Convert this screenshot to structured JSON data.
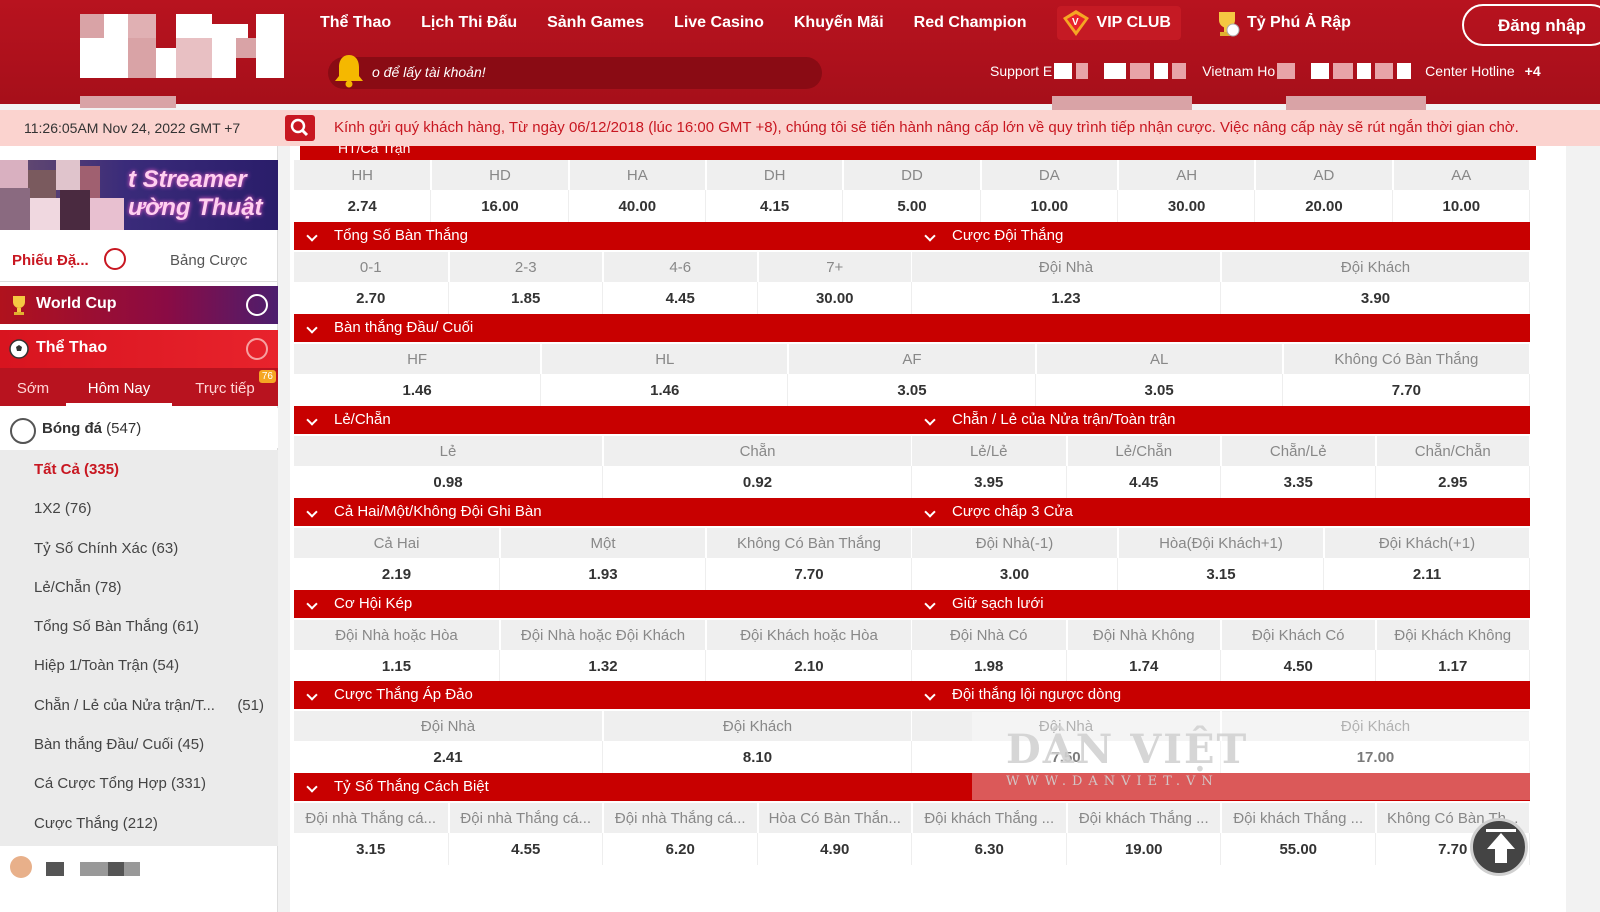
{
  "header": {
    "nav": [
      "Thể Thao",
      "Lịch Thi Đấu",
      "Sảnh Games",
      "Live Casino",
      "Khuyến Mãi",
      "Red Champion"
    ],
    "vip_label": "VIP CLUB",
    "ty_phu_label": "Tỷ Phú Ả Rập",
    "login_label": "Đăng nhập",
    "promo_text": "o để lấy tài khoản!",
    "support_label": "Support E",
    "vietnam_label": "Vietnam Ho",
    "hotline_label": "Center Hotline",
    "hotline_suffix": "+4"
  },
  "ticker": {
    "time": "11:26:05AM Nov 24, 2022 GMT +7",
    "message": "Kính gửi quý khách hàng, Từ ngày 06/12/2018 (lúc 16:00 GMT +8), chúng tôi sẽ tiến hành nâng cấp lớn về quy trình tiếp nhận cược. Việc nâng cấp này sẽ rút ngắn thời gian chờ."
  },
  "sidebar": {
    "banner_line1": "t Streamer",
    "banner_line2": "ường Thuật",
    "tab_active": "Phiếu Đặ...",
    "tab_other": "Bảng Cược",
    "world_cup": "World Cup",
    "the_thao": "Thể Thao",
    "subtabs": [
      "Sớm",
      "Hôm Nay",
      "Trực tiếp"
    ],
    "live_count": "76",
    "sport": "Bóng đá",
    "sport_count": "(547)",
    "items": [
      {
        "label": "Tất Cả (335)",
        "count": ""
      },
      {
        "label": "1X2 (76)",
        "count": ""
      },
      {
        "label": "Tỷ Số Chính Xác (63)",
        "count": ""
      },
      {
        "label": "Lẻ/Chẵn (78)",
        "count": ""
      },
      {
        "label": "Tổng Số Bàn Thắng (61)",
        "count": ""
      },
      {
        "label": "Hiệp 1/Toàn Trận (54)",
        "count": ""
      },
      {
        "label": "Chẵn / Lẻ của Nửa trận/T...",
        "count": "(51)"
      },
      {
        "label": "Bàn thắng Đầu/ Cuối (45)",
        "count": ""
      },
      {
        "label": "Cá Cược Tổng Hợp (331)",
        "count": ""
      },
      {
        "label": "Cược Thắng (212)",
        "count": ""
      }
    ]
  },
  "odds": {
    "top_header": "HT/Cả Trận",
    "top": {
      "labels": [
        "HH",
        "HD",
        "HA",
        "DH",
        "DD",
        "DA",
        "AH",
        "AD",
        "AA"
      ],
      "values": [
        "2.74",
        "16.00",
        "40.00",
        "4.15",
        "5.00",
        "10.00",
        "30.00",
        "20.00",
        "10.00"
      ]
    },
    "row1": {
      "left": {
        "title": "Tổng Số Bàn Thắng",
        "labels": [
          "0-1",
          "2-3",
          "4-6",
          "7+"
        ],
        "values": [
          "2.70",
          "1.85",
          "4.45",
          "30.00"
        ]
      },
      "right": {
        "title": "Cược Đội Thắng",
        "labels": [
          "Đội Nhà",
          "Đội Khách"
        ],
        "values": [
          "1.23",
          "3.90"
        ]
      }
    },
    "row2": {
      "title": "Bàn thắng Đầu/ Cuối",
      "labels": [
        "HF",
        "HL",
        "AF",
        "AL",
        "Không Có Bàn Thắng"
      ],
      "values": [
        "1.46",
        "1.46",
        "3.05",
        "3.05",
        "7.70"
      ]
    },
    "row3": {
      "left": {
        "title": "Lẻ/Chẵn",
        "labels": [
          "Lẻ",
          "Chẵn"
        ],
        "values": [
          "0.98",
          "0.92"
        ]
      },
      "right": {
        "title": "Chẵn / Lẻ của Nửa trận/Toàn trận",
        "labels": [
          "Lẻ/Lẻ",
          "Lẻ/Chẵn",
          "Chẵn/Lẻ",
          "Chẵn/Chẵn"
        ],
        "values": [
          "3.95",
          "4.45",
          "3.35",
          "2.95"
        ]
      }
    },
    "row4": {
      "left": {
        "title": "Cả Hai/Một/Không Đội Ghi Bàn",
        "labels": [
          "Cả Hai",
          "Một",
          "Không Có Bàn Thắng"
        ],
        "values": [
          "2.19",
          "1.93",
          "7.70"
        ]
      },
      "right": {
        "title": "Cược chấp 3 Cửa",
        "labels": [
          "Đội Nhà(-1)",
          "Hòa(Đội Khách+1)",
          "Đội Khách(+1)"
        ],
        "values": [
          "3.00",
          "3.15",
          "2.11"
        ]
      }
    },
    "row5": {
      "left": {
        "title": "Cơ Hội Kép",
        "labels": [
          "Đội Nhà hoặc Hòa",
          "Đội Nhà hoặc Đội Khách",
          "Đội Khách hoặc Hòa"
        ],
        "values": [
          "1.15",
          "1.32",
          "2.10"
        ]
      },
      "right": {
        "title": "Giữ sạch lưới",
        "labels": [
          "Đội Nhà Có",
          "Đội Nhà Không",
          "Đội Khách Có",
          "Đội Khách Không"
        ],
        "values": [
          "1.98",
          "1.74",
          "4.50",
          "1.17"
        ]
      }
    },
    "row6": {
      "left": {
        "title": "Cược Thắng Áp Đảo",
        "labels": [
          "Đội Nhà",
          "Đội Khách"
        ],
        "values": [
          "2.41",
          "8.10"
        ]
      },
      "right": {
        "title": "Đội thắng lội ngược dòng",
        "labels": [
          "Đội Nhà",
          "Đội Khách"
        ],
        "values": [
          "7.50",
          "17.00"
        ]
      }
    },
    "row7": {
      "title": "Tỷ Số Thắng Cách Biệt",
      "labels": [
        "Đội nhà Thắng cá...",
        "Đội nhà Thắng cá...",
        "Đội nhà Thắng cá...",
        "Hòa Có Bàn Thắn...",
        "Đội khách Thắng ...",
        "Đội khách Thắng ...",
        "Đội khách Thắng ...",
        "Không Có Bàn Th..."
      ],
      "values": [
        "3.15",
        "4.55",
        "6.20",
        "4.90",
        "6.30",
        "19.00",
        "55.00",
        "7.70"
      ]
    }
  },
  "watermark": {
    "line1": "DÂN VIỆT",
    "line2": "WWW.DANVIET.VN"
  },
  "colors": {
    "brand_red": "#b8131f",
    "section_red": "#c80000",
    "ticker_bg": "#fbd3cf"
  }
}
